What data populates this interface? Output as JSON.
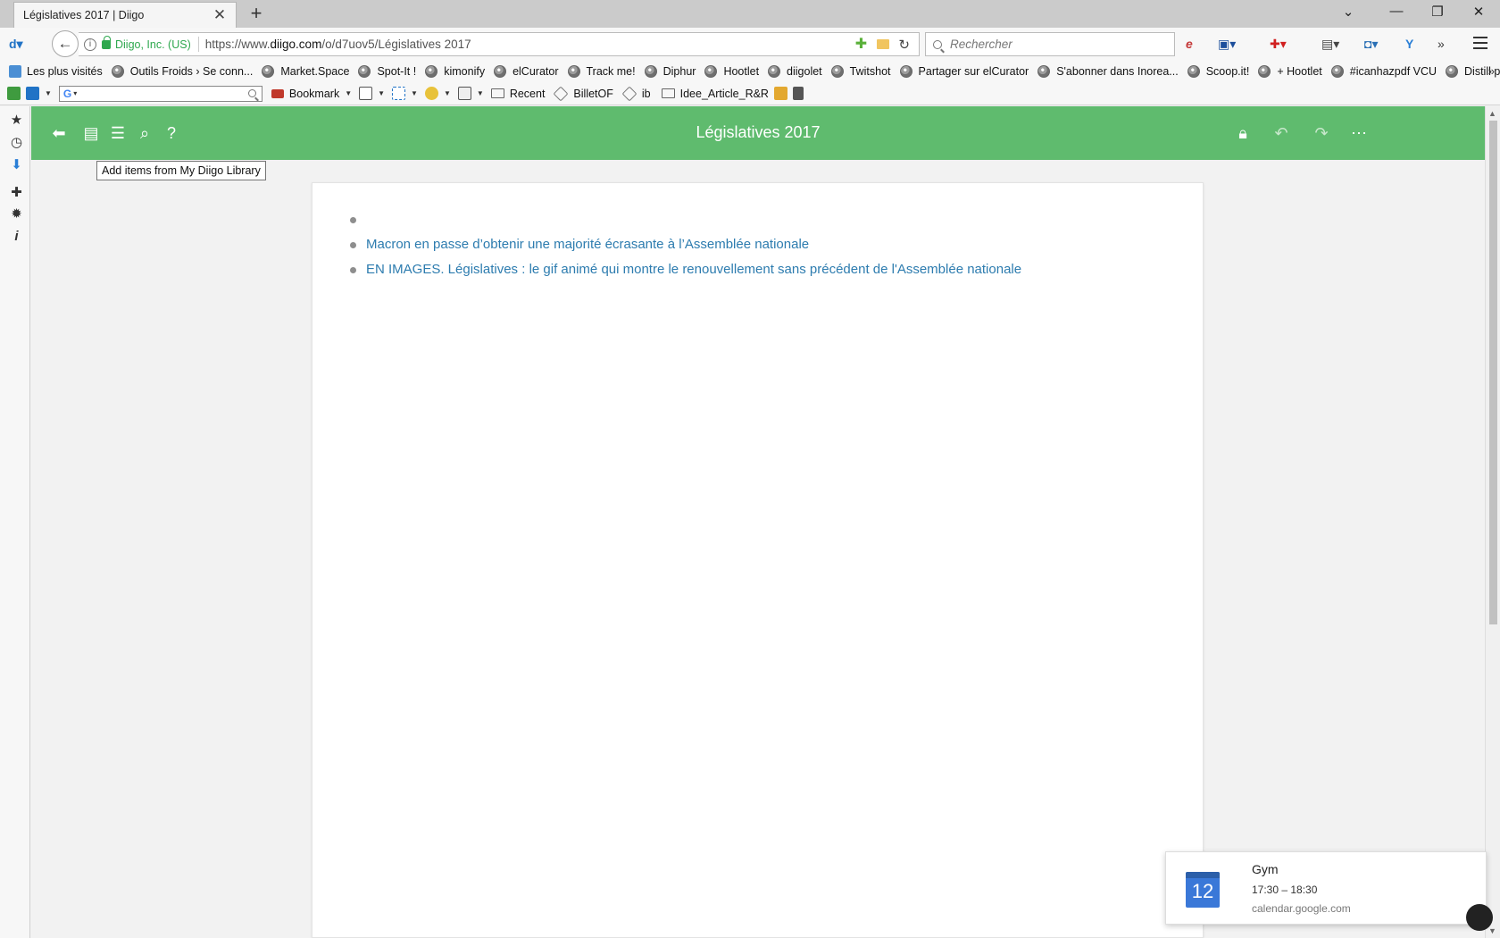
{
  "tab": {
    "title": "Législatives 2017 | Diigo",
    "close": "✕",
    "new_tab": "+"
  },
  "window_controls": {
    "dropdown": "⌄",
    "minimize": "—",
    "restore": "❐",
    "close": "✕"
  },
  "navbar": {
    "back": "←",
    "info": "i",
    "site_identity": "Diigo, Inc. (US)",
    "url_prefix": "https://www.",
    "url_host": "diigo.com",
    "url_path": "/o/d7uov5/Législatives 2017",
    "reload": "↻",
    "search_placeholder": "Rechercher",
    "overflow": "»"
  },
  "bookmarks": [
    {
      "label": "Les plus visités"
    },
    {
      "label": "Outils Froids › Se conn..."
    },
    {
      "label": "Market.Space"
    },
    {
      "label": "Spot-It !"
    },
    {
      "label": "kimonify"
    },
    {
      "label": "elCurator"
    },
    {
      "label": "Track me!"
    },
    {
      "label": "Diphur"
    },
    {
      "label": "Hootlet"
    },
    {
      "label": "diigolet"
    },
    {
      "label": "Twitshot"
    },
    {
      "label": "Partager sur elCurator"
    },
    {
      "label": "S'abonner dans Inorea..."
    },
    {
      "label": "Scoop.it!"
    },
    {
      "label": "+ Hootlet"
    },
    {
      "label": "#icanhazpdf VCU"
    },
    {
      "label": "Distill page"
    }
  ],
  "bookmarks_overflow": "»",
  "toolbar2": {
    "google_logo": "G",
    "bookmark_label": "Bookmark",
    "recent_label": "Recent",
    "tag1": "BilletOF",
    "tag2": "ib",
    "folder": "Idee_Article_R&R"
  },
  "header": {
    "title": "Législatives 2017",
    "tooltip": "Add items from My Diigo Library"
  },
  "items": [
    {
      "text": ""
    },
    {
      "text": "Macron en passe d’obtenir une majorité écrasante à l’Assemblée nationale"
    },
    {
      "text": "EN IMAGES. Législatives : le gif animé qui montre le renouvellement sans précédent de l'Assemblée nationale"
    }
  ],
  "notification": {
    "day": "12",
    "title": "Gym",
    "time": "17:30 – 18:30",
    "source": "calendar.google.com"
  },
  "colors": {
    "header_green": "#5fbb6e",
    "link_blue": "#2d7caf",
    "calendar_blue": "#3a78d8"
  }
}
